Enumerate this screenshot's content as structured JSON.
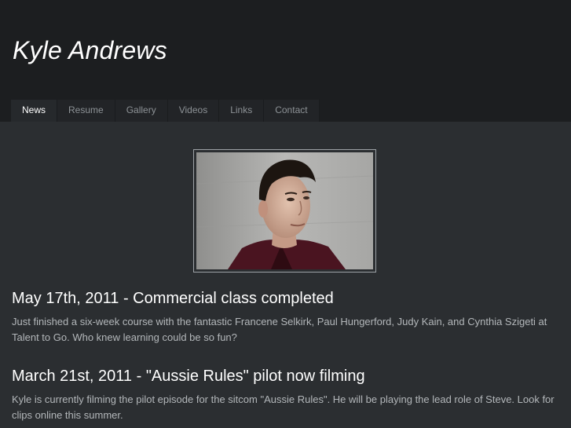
{
  "site": {
    "title": "Kyle Andrews"
  },
  "nav": {
    "items": [
      {
        "label": "News",
        "active": true
      },
      {
        "label": "Resume",
        "active": false
      },
      {
        "label": "Gallery",
        "active": false
      },
      {
        "label": "Videos",
        "active": false
      },
      {
        "label": "Links",
        "active": false
      },
      {
        "label": "Contact",
        "active": false
      }
    ]
  },
  "posts": [
    {
      "title": "May 17th, 2011 - Commercial class completed",
      "body": "Just finished a six-week course with the fantastic Francene Selkirk, Paul Hungerford, Judy Kain, and Cynthia Szigeti at Talent to Go.  Who knew learning could be so fun?"
    },
    {
      "title": "March 21st, 2011 - \"Aussie Rules\" pilot now filming",
      "body": "Kyle is currently filming the pilot episode for the sitcom \"Aussie Rules\".  He will be playing the lead role of Steve.  Look for clips online this summer."
    }
  ],
  "colors": {
    "background": "#2b2e31",
    "header": "#1c1e20",
    "nav_text": "#8d9296",
    "nav_active_text": "#ffffff",
    "body_text": "#b3b7ba"
  }
}
